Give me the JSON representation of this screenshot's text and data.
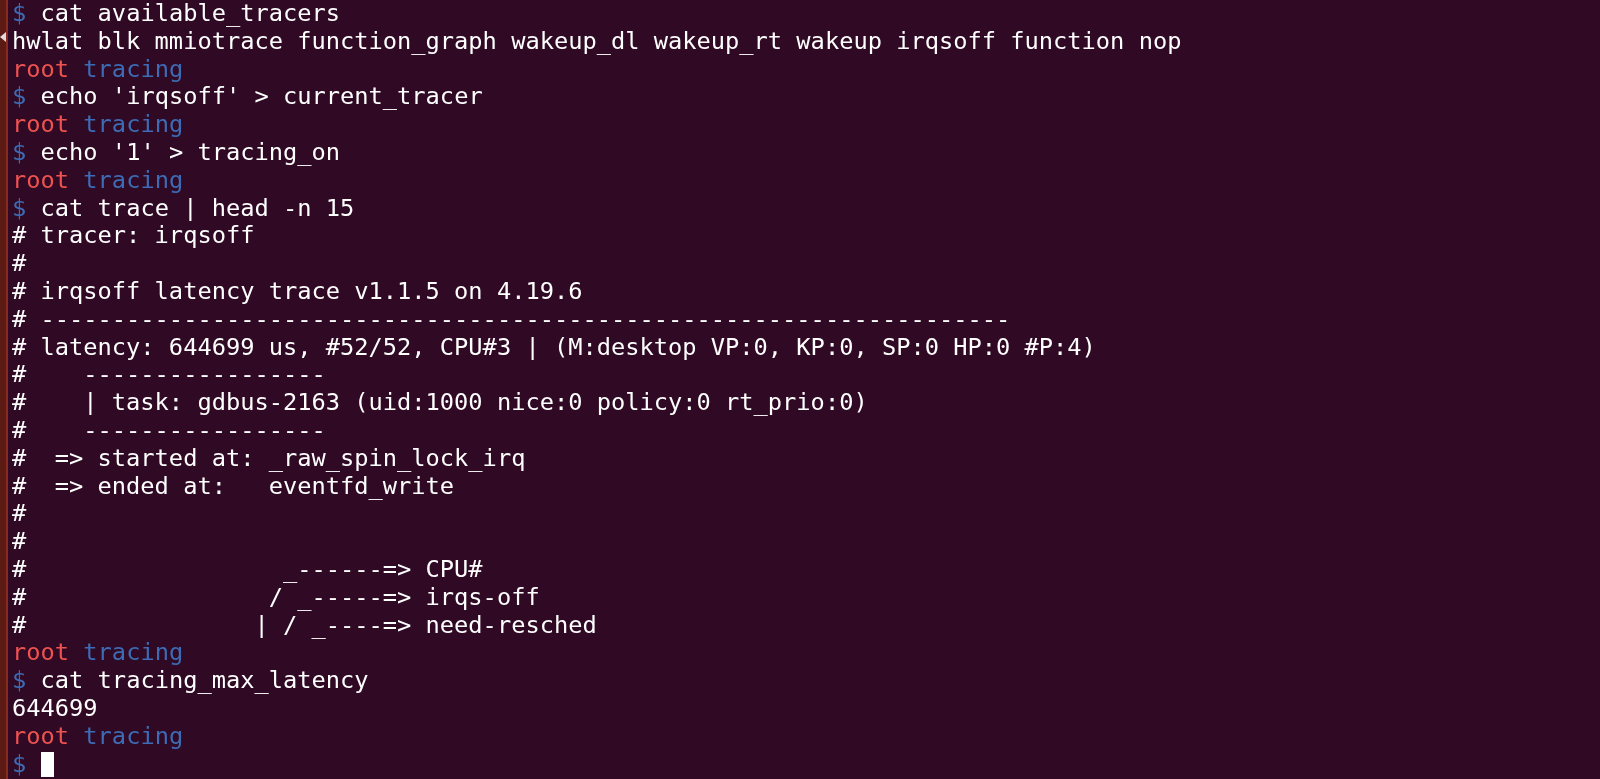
{
  "terminal": {
    "lines": [
      {
        "kind": "command",
        "symbol": "$",
        "text": "cat available_tracers"
      },
      {
        "kind": "output",
        "text": "hwlat blk mmiotrace function_graph wakeup_dl wakeup_rt wakeup irqsoff function nop"
      },
      {
        "kind": "prompt",
        "user": "root",
        "dir": "tracing"
      },
      {
        "kind": "command",
        "symbol": "$",
        "text": "echo 'irqsoff' > current_tracer"
      },
      {
        "kind": "prompt",
        "user": "root",
        "dir": "tracing"
      },
      {
        "kind": "command",
        "symbol": "$",
        "text": "echo '1' > tracing_on"
      },
      {
        "kind": "prompt",
        "user": "root",
        "dir": "tracing"
      },
      {
        "kind": "command",
        "symbol": "$",
        "text": "cat trace | head -n 15"
      },
      {
        "kind": "output",
        "text": "# tracer: irqsoff"
      },
      {
        "kind": "output",
        "text": "#"
      },
      {
        "kind": "output",
        "text": "# irqsoff latency trace v1.1.5 on 4.19.6"
      },
      {
        "kind": "output",
        "text": "# --------------------------------------------------------------------"
      },
      {
        "kind": "output",
        "text": "# latency: 644699 us, #52/52, CPU#3 | (M:desktop VP:0, KP:0, SP:0 HP:0 #P:4)"
      },
      {
        "kind": "output",
        "text": "#    -----------------"
      },
      {
        "kind": "output",
        "text": "#    | task: gdbus-2163 (uid:1000 nice:0 policy:0 rt_prio:0)"
      },
      {
        "kind": "output",
        "text": "#    -----------------"
      },
      {
        "kind": "output",
        "text": "#  => started at: _raw_spin_lock_irq"
      },
      {
        "kind": "output",
        "text": "#  => ended at:   eventfd_write"
      },
      {
        "kind": "output",
        "text": "#"
      },
      {
        "kind": "output",
        "text": "#"
      },
      {
        "kind": "output",
        "text": "#                  _------=> CPU#"
      },
      {
        "kind": "output",
        "text": "#                 / _-----=> irqs-off"
      },
      {
        "kind": "output",
        "text": "#                | / _----=> need-resched"
      },
      {
        "kind": "prompt",
        "user": "root",
        "dir": "tracing"
      },
      {
        "kind": "command",
        "symbol": "$",
        "text": "cat tracing_max_latency"
      },
      {
        "kind": "output",
        "text": "644699"
      },
      {
        "kind": "prompt",
        "user": "root",
        "dir": "tracing"
      },
      {
        "kind": "input",
        "symbol": "$"
      }
    ]
  }
}
